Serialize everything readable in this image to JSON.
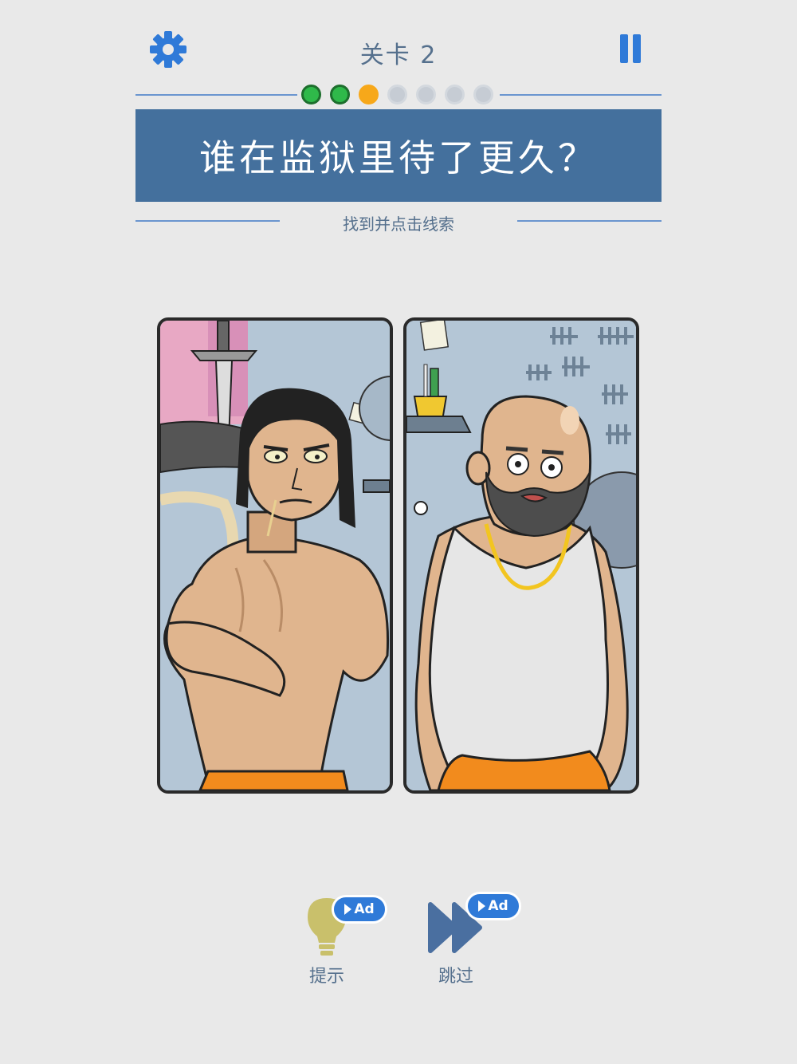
{
  "header": {
    "level_label": "关卡 2",
    "settings_icon": "gear-icon",
    "pause_icon": "pause-icon",
    "accent_color": "#2f7ad8"
  },
  "progress": {
    "total": 7,
    "completed": 2,
    "current": 3,
    "colors": {
      "done": "#2fb94a",
      "current": "#f7a81a",
      "todo": "#c6ccd4"
    }
  },
  "question": {
    "text": "谁在监狱里待了更久？",
    "banner_color": "#44709d"
  },
  "instruction": "找到并点击线索",
  "panels": [
    {
      "id": "left",
      "character": "muscular-inmate-icon"
    },
    {
      "id": "right",
      "character": "bald-bearded-inmate-icon"
    }
  ],
  "actions": [
    {
      "id": "hint",
      "label": "提示",
      "icon": "lightbulb-icon",
      "badge": "Ad"
    },
    {
      "id": "skip",
      "label": "跳过",
      "icon": "fast-forward-icon",
      "badge": "Ad"
    }
  ]
}
